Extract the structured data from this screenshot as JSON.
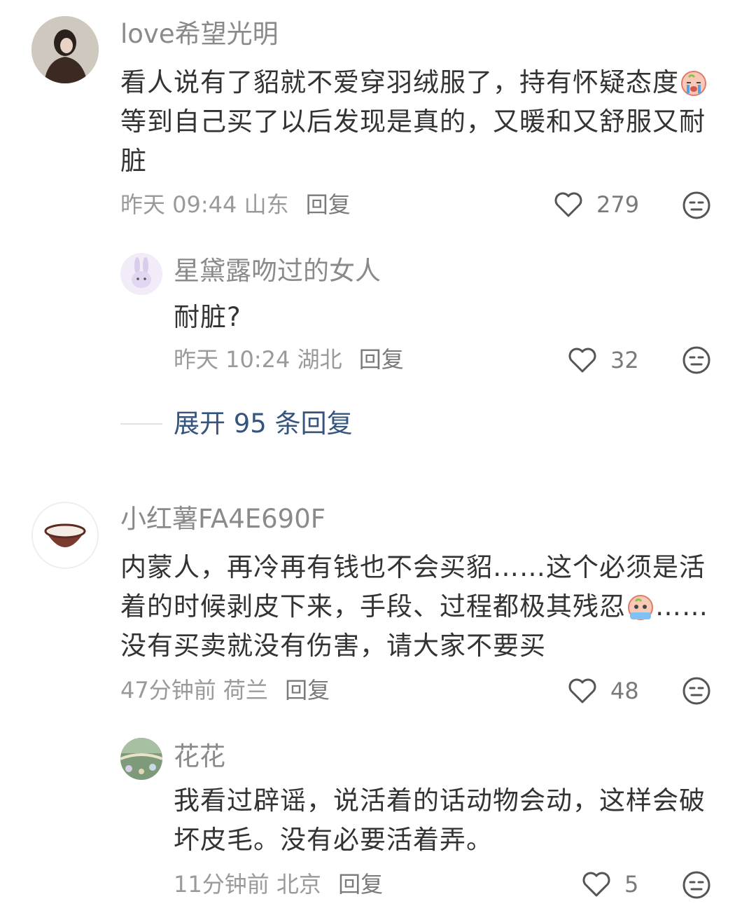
{
  "comments": [
    {
      "user": "love希望光明",
      "text_before": "看人说有了貂就不爱穿羽绒服了，持有怀疑态度",
      "emoji": "crying-face-emoji",
      "text_after": "等到自己买了以后发现是真的，又暖和又舒服又耐脏",
      "time": "昨天 09:44",
      "location": "山东",
      "reply_label": "回复",
      "likes": "279",
      "replies": [
        {
          "user": "星黛露吻过的女人",
          "text": "耐脏?",
          "time": "昨天 10:24",
          "location": "湖北",
          "reply_label": "回复",
          "likes": "32"
        }
      ],
      "expand_label": "展开 95 条回复"
    },
    {
      "user": "小红薯FA4E690F",
      "text_before": "内蒙人，再冷再有钱也不会买貂……这个必须是活着的时候剥皮下来，手段、过程都极其残忍",
      "emoji": "crying-face-emoji",
      "text_after": "……没有买卖就没有伤害，请大家不要买",
      "time": "47分钟前",
      "location": "荷兰",
      "reply_label": "回复",
      "likes": "48",
      "replies": [
        {
          "user": "花花",
          "text": "我看过辟谣，说活着的话动物会动，这样会破坏皮毛。没有必要活着弄。",
          "time": "11分钟前",
          "location": "北京",
          "reply_label": "回复",
          "likes": "5"
        }
      ]
    }
  ],
  "icons": {
    "like": "heart-outline-icon",
    "dislike": "neutral-face-icon"
  }
}
